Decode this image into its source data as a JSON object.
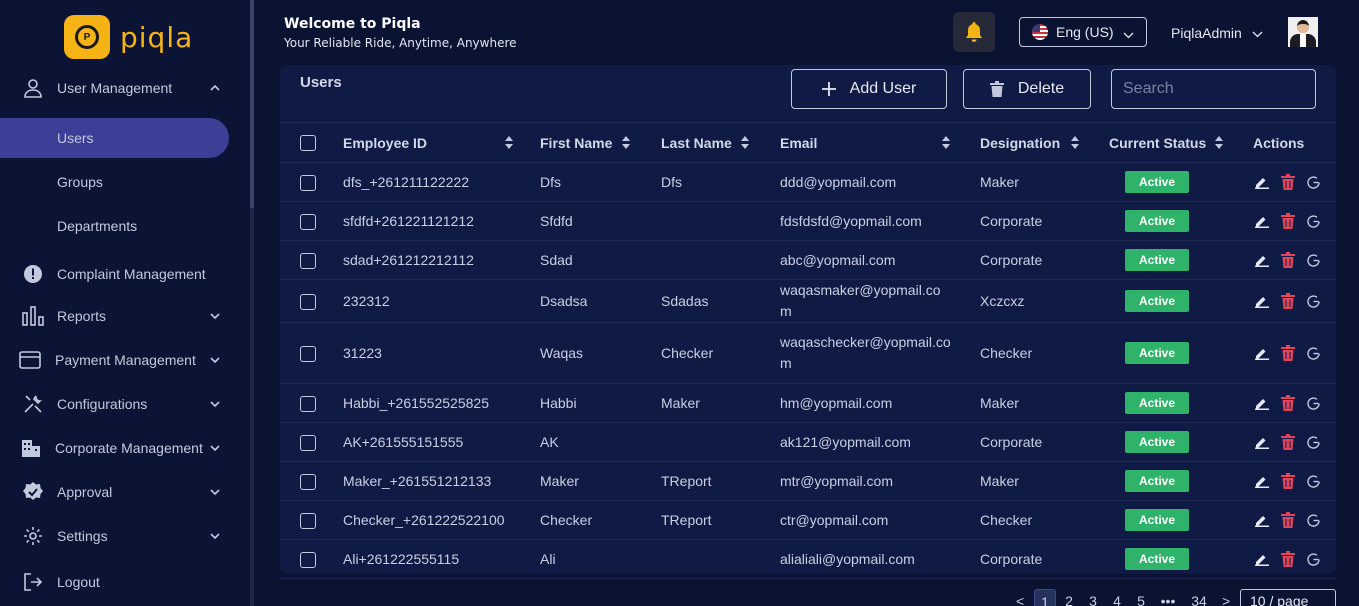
{
  "brand": {
    "logo_text": "piqla",
    "logo_glyph": "P",
    "color": "#f5b315"
  },
  "sidebar": {
    "items": [
      {
        "label": "User Management",
        "icon": "user-icon",
        "expanded": true
      },
      {
        "label": "Complaint Management",
        "icon": "alert-circle-icon"
      },
      {
        "label": "Reports",
        "icon": "bar-chart-icon"
      },
      {
        "label": "Payment Management",
        "icon": "credit-card-icon"
      },
      {
        "label": "Configurations",
        "icon": "tools-icon"
      },
      {
        "label": "Corporate Management",
        "icon": "building-icon"
      },
      {
        "label": "Approval",
        "icon": "badge-check-icon"
      },
      {
        "label": "Settings",
        "icon": "gear-icon"
      },
      {
        "label": "Logout",
        "icon": "logout-icon"
      }
    ],
    "sub_items": [
      {
        "label": "Users",
        "active": true
      },
      {
        "label": "Groups"
      },
      {
        "label": "Departments"
      }
    ],
    "active_color": "#3b3f96"
  },
  "header": {
    "title": "Welcome to Piqla",
    "subtitle": "Your Reliable Ride, Anytime, Anywhere",
    "language": "Eng (US)",
    "username": "PiqlaAdmin"
  },
  "users_card": {
    "title": "Users",
    "add_label": "Add User",
    "delete_label": "Delete",
    "search_placeholder": "Search"
  },
  "table": {
    "columns": [
      "Employee ID",
      "First Name",
      "Last Name",
      "Email",
      "Designation",
      "Current Status",
      "Actions"
    ],
    "rows": [
      {
        "employee_id": "dfs_+261211122222",
        "first_name": "Dfs",
        "last_name": "Dfs",
        "email": "ddd@yopmail.com",
        "designation": "Maker",
        "status": "Active"
      },
      {
        "employee_id": "sfdfd+261221121212",
        "first_name": "Sfdfd",
        "last_name": "",
        "email": "fdsfdsfd@yopmail.com",
        "designation": "Corporate",
        "status": "Active"
      },
      {
        "employee_id": "sdad+261212212112",
        "first_name": "Sdad",
        "last_name": "",
        "email": "abc@yopmail.com",
        "designation": "Corporate",
        "status": "Active"
      },
      {
        "employee_id": "232312",
        "first_name": "Dsadsa",
        "last_name": "Sdadas",
        "email": "waqasmaker@yopmail.com",
        "designation": "Xczcxz",
        "status": "Active"
      },
      {
        "employee_id": "31223",
        "first_name": "Waqas",
        "last_name": "Checker",
        "email": "waqaschecker@yopmail.com",
        "designation": "Checker",
        "status": "Active",
        "tall": true
      },
      {
        "employee_id": "Habbi_+261552525825",
        "first_name": "Habbi",
        "last_name": "Maker",
        "email": "hm@yopmail.com",
        "designation": "Maker",
        "status": "Active"
      },
      {
        "employee_id": "AK+261555151555",
        "first_name": "AK",
        "last_name": "",
        "email": "ak121@yopmail.com",
        "designation": "Corporate",
        "status": "Active"
      },
      {
        "employee_id": "Maker_+261551212133",
        "first_name": "Maker",
        "last_name": "TReport",
        "email": "mtr@yopmail.com",
        "designation": "Maker",
        "status": "Active"
      },
      {
        "employee_id": "Checker_+261222522100",
        "first_name": "Checker",
        "last_name": "TReport",
        "email": "ctr@yopmail.com",
        "designation": "Checker",
        "status": "Active"
      },
      {
        "employee_id": "Ali+261222555115",
        "first_name": "Ali",
        "last_name": "",
        "email": "alialiali@yopmail.com",
        "designation": "Corporate",
        "status": "Active"
      }
    ],
    "status_color": "#2fb36b",
    "delete_color": "#e0445a"
  },
  "pagination": {
    "prev": "<",
    "next": ">",
    "pages": [
      "1",
      "2",
      "3",
      "4",
      "5"
    ],
    "ellipsis": "•••",
    "last_page": "34",
    "current": "1",
    "page_size": "10 / page"
  }
}
